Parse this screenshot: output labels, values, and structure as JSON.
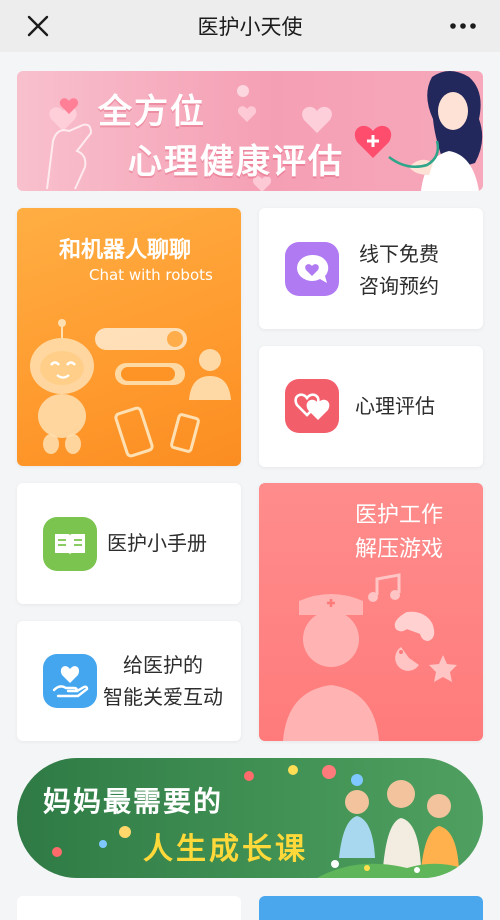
{
  "nav": {
    "title": "医护小天使"
  },
  "banner_top": {
    "line1": "全方位",
    "line2": "心理健康评估"
  },
  "tiles": {
    "robot": {
      "title": "和机器人聊聊",
      "subtitle": "Chat with robots"
    },
    "free_consult": {
      "line1": "线下免费",
      "line2": "咨询预约"
    },
    "evaluation": {
      "title": "心理评估"
    },
    "manual": {
      "title": "医护小手册"
    },
    "love": {
      "line1": "给医护的",
      "line2": "智能关爱互动"
    },
    "game": {
      "line1": "医护工作",
      "line2": "解压游戏"
    }
  },
  "banner_bottom": {
    "line1": "妈妈最需要的",
    "line2": "人生成长课"
  },
  "colors": {
    "robot_card": "#ff9f33",
    "game_card": "#ff7f7f",
    "free_icon": "#b07af3",
    "eval_icon": "#f25f6b",
    "manual_icon": "#7bc44f",
    "love_icon": "#45a6f0",
    "banner_top": "#f7a8bb",
    "banner_bottom": "#3b8a50",
    "accent_yellow": "#ffd93a"
  }
}
